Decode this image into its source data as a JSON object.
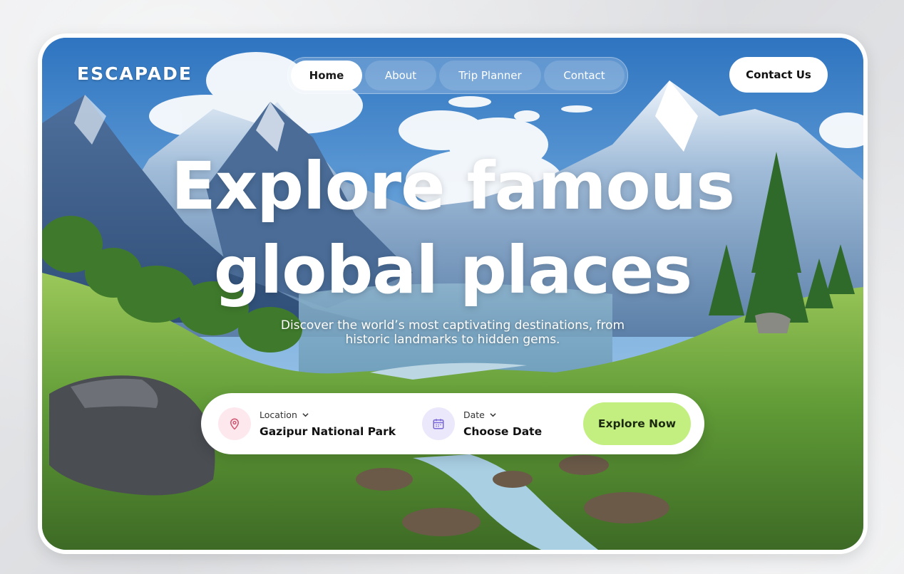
{
  "brand": {
    "logo": "ESCAPADE"
  },
  "nav": {
    "items": [
      {
        "label": "Home",
        "active": true
      },
      {
        "label": "About",
        "active": false
      },
      {
        "label": "Trip Planner",
        "active": false
      },
      {
        "label": "Contact",
        "active": false
      }
    ],
    "cta_label": "Contact Us"
  },
  "hero": {
    "headline_line1": "Explore famous",
    "headline_line2": "global places",
    "subtitle_line1": "Discover the world’s most captivating destinations, from",
    "subtitle_line2": "historic landmarks to hidden gems."
  },
  "search": {
    "location": {
      "label": "Location",
      "value": "Gazipur National Park",
      "icon": "map-pin-icon"
    },
    "date": {
      "label": "Date",
      "value": "Choose Date",
      "icon": "calendar-icon"
    },
    "submit_label": "Explore Now"
  },
  "colors": {
    "accent_button": "#c2ef7f",
    "location_icon_bg": "#fde8ee",
    "location_icon": "#d2556f",
    "date_icon_bg": "#ece8fb",
    "date_icon": "#7a68d8"
  }
}
